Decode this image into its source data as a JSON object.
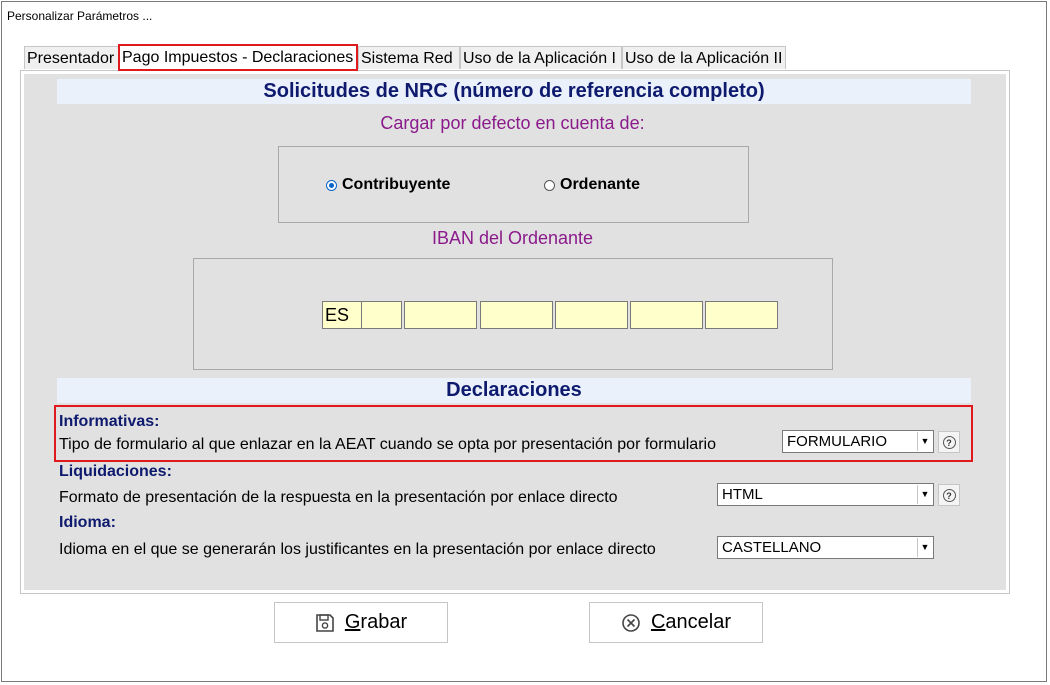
{
  "window": {
    "title": "Personalizar Parámetros ..."
  },
  "tabs": [
    {
      "label": "Presentador",
      "active": false
    },
    {
      "label": "Pago Impuestos - Declaraciones",
      "active": true
    },
    {
      "label": "Sistema Red",
      "active": false
    },
    {
      "label": "Uso de la Aplicación I",
      "active": false
    },
    {
      "label": "Uso de la Aplicación II",
      "active": false
    }
  ],
  "nrc": {
    "header": "Solicitudes de NRC (número de referencia completo)",
    "default_account_label": "Cargar por defecto en cuenta de:",
    "options": [
      {
        "label": "Contribuyente",
        "checked": true
      },
      {
        "label": "Ordenante",
        "checked": false
      }
    ],
    "iban_label": "IBAN del Ordenante",
    "iban_fields": [
      "ES",
      "",
      "",
      "",
      "",
      "",
      ""
    ]
  },
  "declaraciones": {
    "header": "Declaraciones",
    "informativas": {
      "title": "Informativas:",
      "description": "Tipo de formulario al que enlazar en la AEAT cuando se opta por presentación por formulario",
      "value": "FORMULARIO"
    },
    "liquidaciones": {
      "title": "Liquidaciones:",
      "description": "Formato de presentación de la respuesta en la presentación por enlace directo",
      "value": "HTML"
    },
    "idioma": {
      "title": "Idioma:",
      "description": "Idioma en el que se generarán los justificantes en la presentación por enlace directo",
      "value": "CASTELLANO"
    }
  },
  "buttons": {
    "save": "Grabar",
    "cancel": "Cancelar"
  },
  "colors": {
    "header_text": "#0e1a6e",
    "purple_label": "#8b1a8b",
    "highlight": "#e0191f",
    "iban_bg": "#ffffcc",
    "panel_bg": "#e1e1e1"
  }
}
